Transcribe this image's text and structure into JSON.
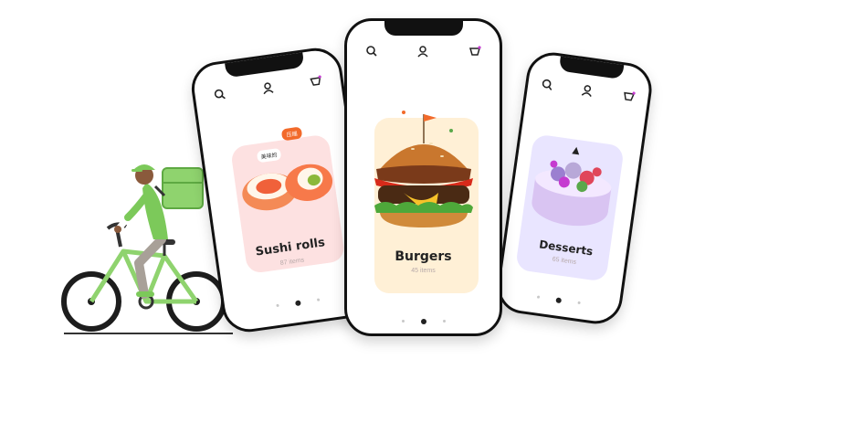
{
  "phones": {
    "left": {
      "title": "Sushi rolls",
      "count": "87 items",
      "tag_left": "美味的",
      "tag_right": "压缩"
    },
    "center": {
      "title": "Burgers",
      "count": "45 items"
    },
    "right": {
      "title": "Desserts",
      "count": "65 items"
    }
  },
  "icons": {
    "search": "search-icon",
    "profile": "user-icon",
    "cart": "basket-icon"
  },
  "colors": {
    "courier_shirt": "#7cc95a",
    "bike_frame": "#8fd36e",
    "sushi_card": "#fde1e1",
    "burger_card": "#fff0d6",
    "dessert_card": "#e9e5ff",
    "accent_orange": "#f26a2a"
  }
}
